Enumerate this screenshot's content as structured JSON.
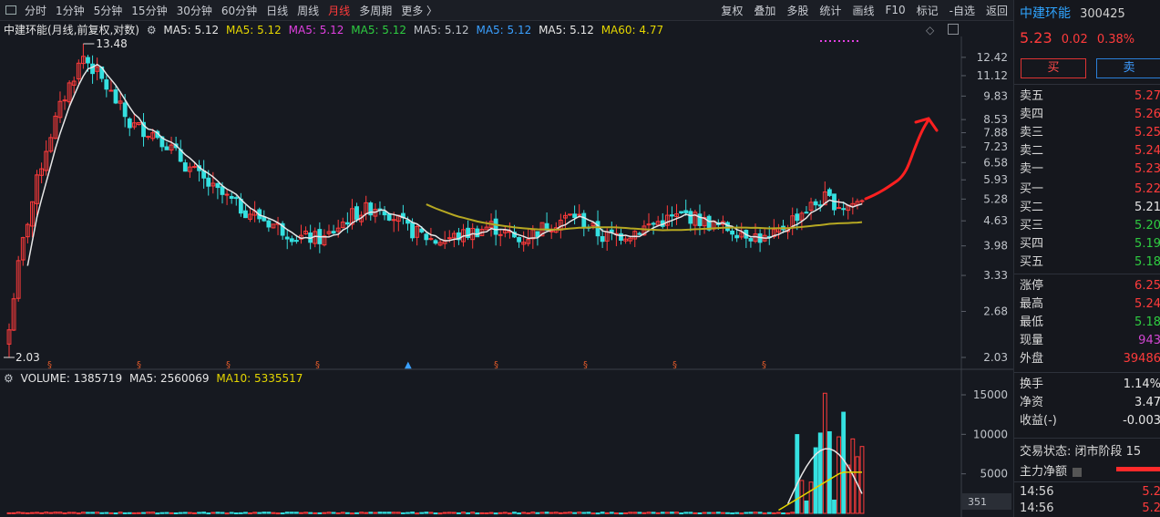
{
  "toolbar": {
    "left_items": [
      "分时",
      "1分钟",
      "5分钟",
      "15分钟",
      "30分钟",
      "60分钟",
      "日线",
      "周线",
      "月线",
      "多周期",
      "更多"
    ],
    "active_item": "月线",
    "right_items": [
      "复权",
      "叠加",
      "多股",
      "统计",
      "画线",
      "F10",
      "标记",
      "-自选",
      "返回"
    ]
  },
  "chart_header": {
    "title": "中建环能(月线,前复权,对数)",
    "ma_labels": [
      {
        "text": "MA5: 5.12",
        "color": "#e6e6e6"
      },
      {
        "text": "MA5: 5.12",
        "color": "#e5d600"
      },
      {
        "text": "MA5: 5.12",
        "color": "#e040e0"
      },
      {
        "text": "MA5: 5.12",
        "color": "#2ecc40"
      },
      {
        "text": "MA5: 5.12",
        "color": "#bfc3c9"
      },
      {
        "text": "MA5: 5.12",
        "color": "#3aa0ff"
      },
      {
        "text": "MA5: 5.12",
        "color": "#e6e6e6"
      },
      {
        "text": "MA60: 4.77",
        "color": "#e5d600"
      }
    ]
  },
  "volume_header": {
    "volume": "VOLUME: 1385719",
    "ma5": "MA5: 2560069",
    "ma10": "MA10: 5335517"
  },
  "chart_data": {
    "type": "candlestick",
    "price_axis_ticks": [
      12.42,
      11.12,
      9.83,
      8.53,
      7.88,
      7.23,
      6.58,
      5.93,
      5.28,
      4.63,
      3.98,
      3.33,
      2.68,
      2.03
    ],
    "volume_axis_ticks": [
      15000,
      10000,
      5000
    ],
    "volume_axis_corner_label": "351",
    "max_label": "13.48",
    "min_label": "2.03",
    "colors": {
      "up": "#ff3b3b",
      "down": "#35e0e0",
      "ma_short": "#e6e6e6",
      "ma_long": "#b6a822",
      "annotation": "#ff2020"
    }
  },
  "sidebar": {
    "name": "中建环能",
    "code": "300425",
    "price": "5.23",
    "change": "0.02",
    "change_pct": "0.38%",
    "buy_label": "买",
    "sell_label": "卖",
    "asks": [
      {
        "label": "卖五",
        "value": "5.27"
      },
      {
        "label": "卖四",
        "value": "5.26"
      },
      {
        "label": "卖三",
        "value": "5.25"
      },
      {
        "label": "卖二",
        "value": "5.24"
      },
      {
        "label": "卖一",
        "value": "5.23"
      }
    ],
    "bids": [
      {
        "label": "买一",
        "value": "5.22",
        "color": "red"
      },
      {
        "label": "买二",
        "value": "5.21",
        "color": "white"
      },
      {
        "label": "买三",
        "value": "5.20",
        "color": "green"
      },
      {
        "label": "买四",
        "value": "5.19",
        "color": "green"
      },
      {
        "label": "买五",
        "value": "5.18",
        "color": "green"
      }
    ],
    "stats": [
      {
        "label": "涨停",
        "value": "6.25",
        "color": "red"
      },
      {
        "label": "最高",
        "value": "5.24",
        "color": "red"
      },
      {
        "label": "最低",
        "value": "5.18",
        "color": "green"
      },
      {
        "label": "现量",
        "value": "943",
        "color": "purple"
      },
      {
        "label": "外盘",
        "value": "39486",
        "color": "red"
      }
    ],
    "fundamentals": [
      {
        "label": "换手",
        "value": "1.14%"
      },
      {
        "label": "净资",
        "value": "3.47"
      },
      {
        "label": "收益(-)",
        "value": "-0.003"
      }
    ],
    "trade_status": "交易状态: 闭市阶段 15",
    "main_flow_label": "主力净额",
    "ticks": [
      {
        "time": "14:56",
        "value": "5.2"
      },
      {
        "time": "14:56",
        "value": "5.2"
      }
    ]
  }
}
